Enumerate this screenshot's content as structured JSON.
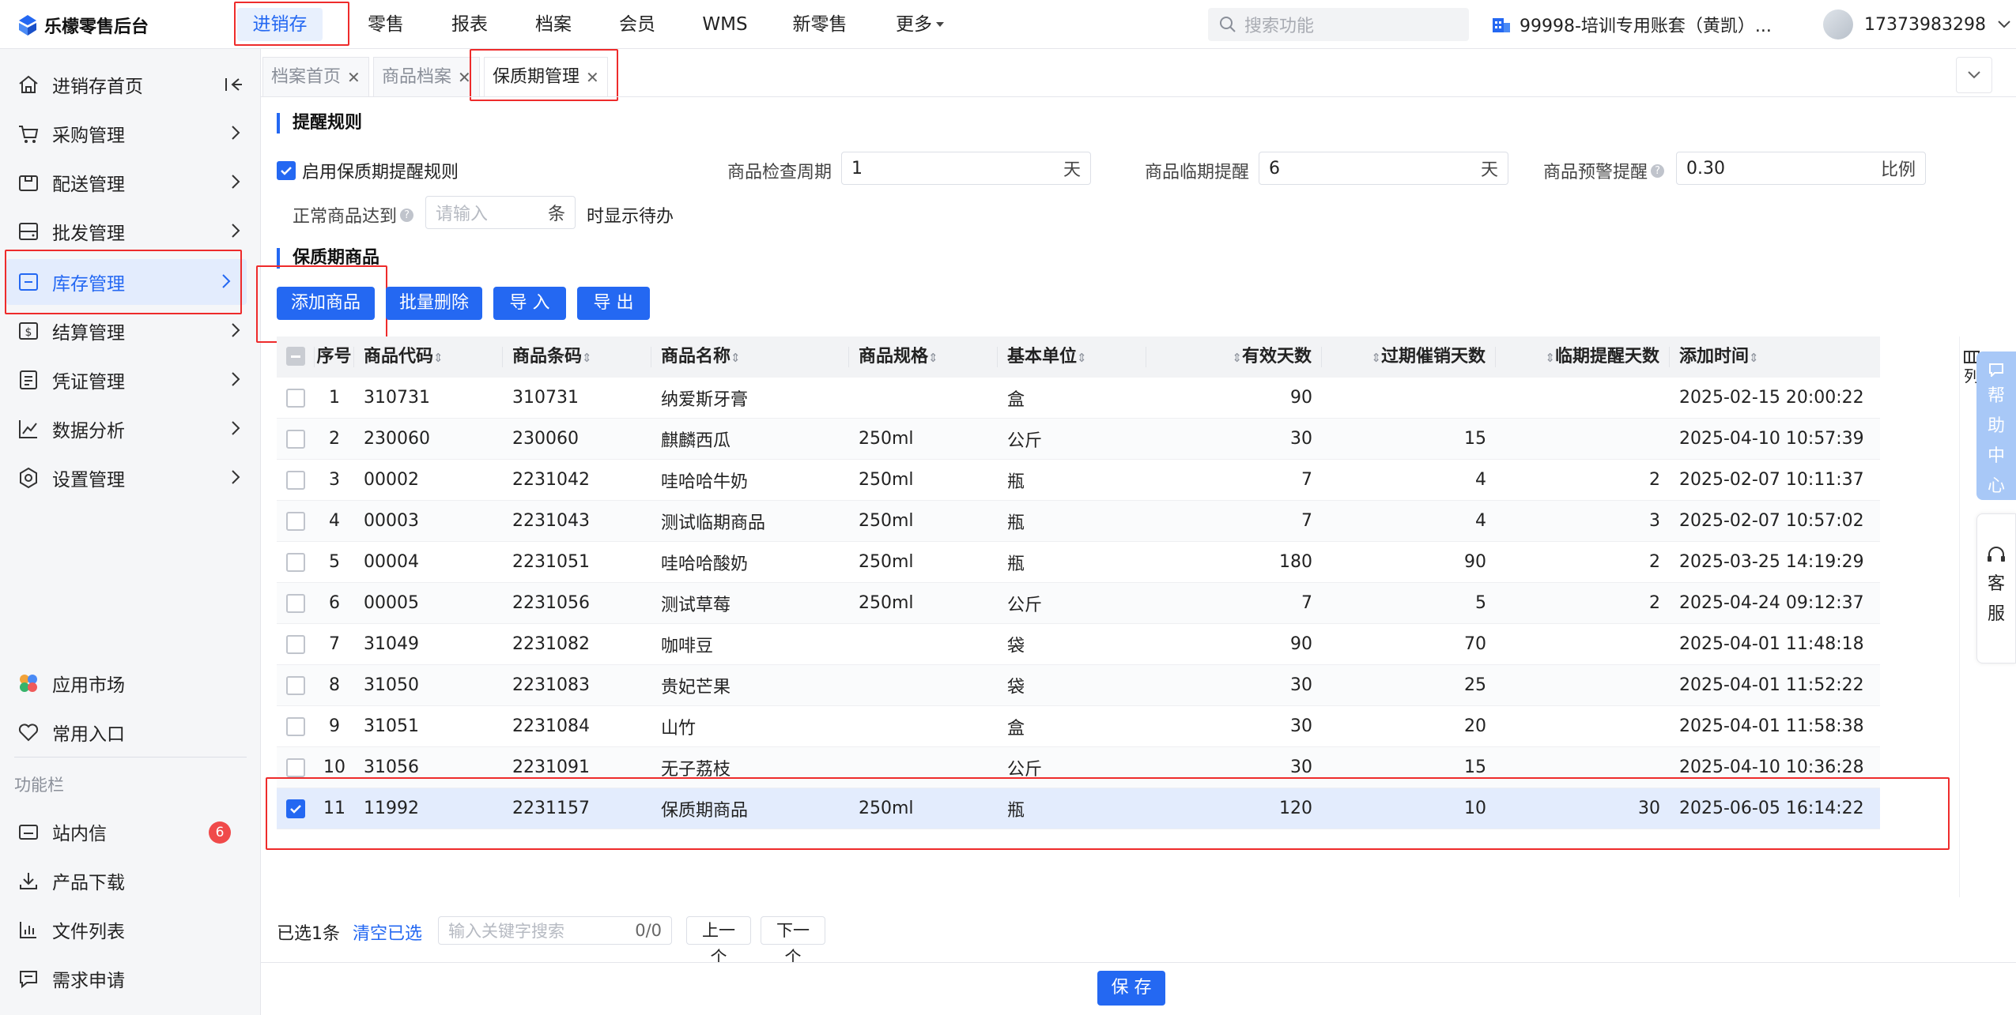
{
  "brand": {
    "name": "乐檬零售后台"
  },
  "topnav": {
    "items": [
      "进销存",
      "零售",
      "报表",
      "档案",
      "会员",
      "WMS",
      "新零售",
      "更多"
    ],
    "search_placeholder": "搜索功能",
    "account": "99998-培训专用账套（黄凯）...",
    "user": "17373983298"
  },
  "sidebar": {
    "main": [
      {
        "label": "进销存首页",
        "icon": "home-icon"
      },
      {
        "label": "采购管理",
        "icon": "cart-icon"
      },
      {
        "label": "配送管理",
        "icon": "delivery-icon"
      },
      {
        "label": "批发管理",
        "icon": "wholesale-icon"
      },
      {
        "label": "库存管理",
        "icon": "inventory-icon"
      },
      {
        "label": "结算管理",
        "icon": "settlement-icon"
      },
      {
        "label": "凭证管理",
        "icon": "voucher-icon"
      },
      {
        "label": "数据分析",
        "icon": "chart-icon"
      },
      {
        "label": "设置管理",
        "icon": "settings-icon"
      }
    ],
    "bottom": [
      {
        "label": "应用市场",
        "icon": "app-market-icon"
      },
      {
        "label": "常用入口",
        "icon": "heart-icon"
      }
    ],
    "section_title": "功能栏",
    "tools": [
      {
        "label": "站内信",
        "icon": "mail-icon",
        "badge": "6"
      },
      {
        "label": "产品下载",
        "icon": "download-icon"
      },
      {
        "label": "文件列表",
        "icon": "file-list-icon"
      },
      {
        "label": "需求申请",
        "icon": "request-icon"
      }
    ]
  },
  "tabs": [
    {
      "label": "档案首页"
    },
    {
      "label": "商品档案"
    },
    {
      "label": "保质期管理"
    }
  ],
  "rules": {
    "title": "提醒规则",
    "enable_label": "启用保质期提醒规则",
    "check_cycle_label": "商品检查周期",
    "check_cycle_value": "1",
    "check_cycle_unit": "天",
    "near_label": "商品临期提醒",
    "near_value": "6",
    "near_unit": "天",
    "warn_label": "商品预警提醒",
    "warn_value": "0.30",
    "warn_unit": "比例",
    "normal_label": "正常商品达到",
    "normal_placeholder": "请输入",
    "normal_unit": "条",
    "normal_suffix": "时显示待办"
  },
  "products": {
    "title": "保质期商品",
    "buttons": {
      "add": "添加商品",
      "batch_delete": "批量删除",
      "import": "导 入",
      "export": "导 出"
    },
    "columns": [
      "序号",
      "商品代码",
      "商品条码",
      "商品名称",
      "商品规格",
      "基本单位",
      "有效天数",
      "过期催销天数",
      "临期提醒天数",
      "添加时间"
    ],
    "column_setting": "列",
    "rows": [
      {
        "no": "1",
        "code": "310731",
        "barcode": "310731",
        "name": "纳爱斯牙膏",
        "spec": "",
        "unit": "盒",
        "valid": "90",
        "expire": "",
        "near": "",
        "time": "2025-02-15 20:00:22"
      },
      {
        "no": "2",
        "code": "230060",
        "barcode": "230060",
        "name": "麒麟西瓜",
        "spec": "250ml",
        "unit": "公斤",
        "valid": "30",
        "expire": "15",
        "near": "",
        "time": "2025-04-10 10:57:39"
      },
      {
        "no": "3",
        "code": "00002",
        "barcode": "2231042",
        "name": "哇哈哈牛奶",
        "spec": "250ml",
        "unit": "瓶",
        "valid": "7",
        "expire": "4",
        "near": "2",
        "time": "2025-02-07 10:11:37"
      },
      {
        "no": "4",
        "code": "00003",
        "barcode": "2231043",
        "name": "测试临期商品",
        "spec": "250ml",
        "unit": "瓶",
        "valid": "7",
        "expire": "4",
        "near": "3",
        "time": "2025-02-07 10:57:02"
      },
      {
        "no": "5",
        "code": "00004",
        "barcode": "2231051",
        "name": "哇哈哈酸奶",
        "spec": "250ml",
        "unit": "瓶",
        "valid": "180",
        "expire": "90",
        "near": "2",
        "time": "2025-03-25 14:19:29"
      },
      {
        "no": "6",
        "code": "00005",
        "barcode": "2231056",
        "name": "测试草莓",
        "spec": "250ml",
        "unit": "公斤",
        "valid": "7",
        "expire": "5",
        "near": "2",
        "time": "2025-04-24 09:12:37"
      },
      {
        "no": "7",
        "code": "31049",
        "barcode": "2231082",
        "name": "咖啡豆",
        "spec": "",
        "unit": "袋",
        "valid": "90",
        "expire": "70",
        "near": "",
        "time": "2025-04-01 11:48:18"
      },
      {
        "no": "8",
        "code": "31050",
        "barcode": "2231083",
        "name": "贵妃芒果",
        "spec": "",
        "unit": "袋",
        "valid": "30",
        "expire": "25",
        "near": "",
        "time": "2025-04-01 11:52:22"
      },
      {
        "no": "9",
        "code": "31051",
        "barcode": "2231084",
        "name": "山竹",
        "spec": "",
        "unit": "盒",
        "valid": "30",
        "expire": "20",
        "near": "",
        "time": "2025-04-01 11:58:38"
      },
      {
        "no": "10",
        "code": "31056",
        "barcode": "2231091",
        "name": "无子荔枝",
        "spec": "",
        "unit": "公斤",
        "valid": "30",
        "expire": "15",
        "near": "",
        "time": "2025-04-10 10:36:28"
      },
      {
        "no": "11",
        "code": "11992",
        "barcode": "2231157",
        "name": "保质期商品",
        "spec": "250ml",
        "unit": "瓶",
        "valid": "120",
        "expire": "10",
        "near": "30",
        "time": "2025-06-05 16:14:22",
        "selected": true
      }
    ]
  },
  "bottom_bar": {
    "selected_count": "已选1条",
    "clear": "清空已选",
    "search_placeholder": "输入关键字搜索",
    "match": "0/0",
    "prev": "上一个",
    "next": "下一个"
  },
  "save_label": "保 存",
  "float": {
    "help": [
      "帮",
      "助",
      "中",
      "心"
    ],
    "service": [
      "客",
      "服"
    ]
  },
  "colors": {
    "primary": "#2468f2",
    "highlight": "#ee2b2b",
    "selected_row": "#e3ecfd"
  }
}
